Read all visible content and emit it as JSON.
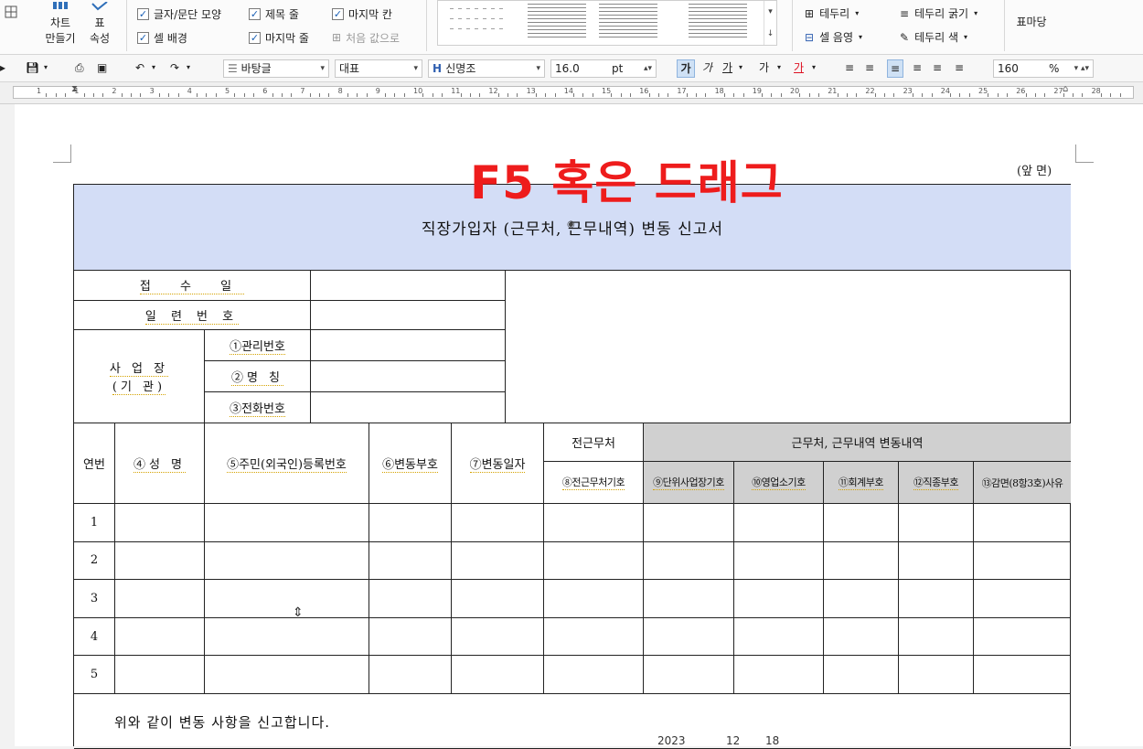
{
  "ribbon": {
    "chart_btn": [
      "차트",
      "만들기"
    ],
    "table_prop_btn": [
      "표",
      "속성"
    ],
    "checks": {
      "char_para": "글자/문단 모양",
      "cell_bg": "셀 배경",
      "title_row": "제목 줄",
      "last_row": "마지막 줄",
      "last_col": "마지막 칸",
      "reset": "처음 값으로"
    },
    "border": "테두리",
    "cell_shade": "셀 음영",
    "border_width": "테두리 굵기",
    "border_color": "테두리 색",
    "table_para": "표마당"
  },
  "toolbar": {
    "style": "바탕글",
    "lang": "대표",
    "font": "신명조",
    "size": "16.0",
    "unit": "pt",
    "zoom": "160",
    "zoom_unit": "%",
    "bold": "가",
    "italic": "가",
    "underline": "가",
    "strike": "가",
    "color": "가"
  },
  "ruler": {
    "numbers": [
      "1",
      "1",
      "2",
      "3",
      "4",
      "5",
      "6",
      "7",
      "8",
      "9",
      "10",
      "11",
      "12",
      "13",
      "14",
      "15",
      "16",
      "17",
      "18",
      "19",
      "20",
      "21",
      "22",
      "23",
      "24",
      "25",
      "26",
      "27",
      "28"
    ]
  },
  "document": {
    "front_mark": "(앞 면)",
    "overlay_text": "F5 혹은 드래그",
    "form_title": "직장가입자 (근무처, 근무내역) 변동 신고서",
    "receipt_date": "접 수 일",
    "serial_no": "일 련 번 호",
    "workplace": [
      "사 업 장",
      "(기 관)"
    ],
    "mgmt_no": "①관리번호",
    "name_lbl": "②명 칭",
    "phone": "③전화번호",
    "col_seq": "연번",
    "col_name": "④성 명",
    "col_rrn": "⑤주민(외국인)등록번호",
    "col_code": "⑥변동부호",
    "col_date": "⑦변동일자",
    "prev_work": "전근무처",
    "prev_work_code": "⑧전근무처기호",
    "change_detail": "근무처, 근무내역 변동내역",
    "sub_headers": [
      "⑨단위사업장기호",
      "⑩영업소기호",
      "⑪회계부호",
      "⑫직종부호",
      "⑬감면(8항3호)사유"
    ],
    "row_numbers": [
      "1",
      "2",
      "3",
      "4",
      "5"
    ],
    "declaration": "위와 같이 변동 사항을 신고합니다.",
    "date_year": "2023",
    "date_month": "12",
    "date_day": "18"
  }
}
